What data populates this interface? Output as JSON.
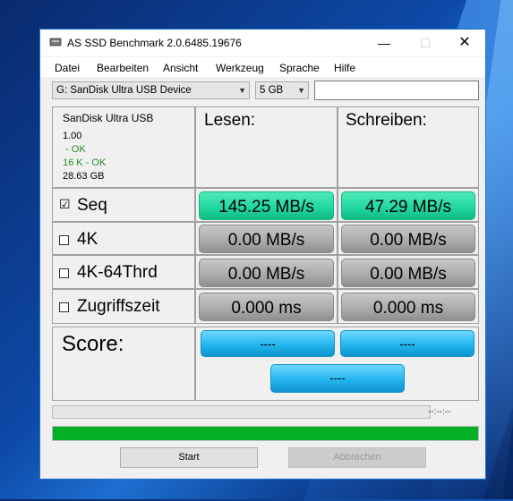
{
  "window": {
    "title": "AS SSD Benchmark 2.0.6485.19676"
  },
  "titlebar": {
    "min_glyph": "—",
    "max_glyph": "☐",
    "close_glyph": "✕"
  },
  "menu": [
    "Datei",
    "Bearbeiten",
    "Ansicht",
    "Werkzeug",
    "Sprache",
    "Hilfe"
  ],
  "toolbar": {
    "drive_select": "G: SanDisk Ultra USB Device",
    "size_select": "5 GB",
    "text_value": ""
  },
  "device": {
    "name": "SanDisk Ultra USB",
    "version": "1.00",
    "driver_status": " - OK",
    "alignment_status": "16 K - OK",
    "capacity": "28.63 GB"
  },
  "columns": {
    "read": "Lesen:",
    "write": "Schreiben:"
  },
  "rows": [
    {
      "label": "Seq",
      "checked": true,
      "read": "145.25 MB/s",
      "write": "47.29 MB/s"
    },
    {
      "label": "4K",
      "checked": false,
      "read": "0.00 MB/s",
      "write": "0.00 MB/s"
    },
    {
      "label": "4K-64Thrd",
      "checked": false,
      "read": "0.00 MB/s",
      "write": "0.00 MB/s"
    },
    {
      "label": "Zugriffszeit",
      "checked": false,
      "read": "0.000 ms",
      "write": "0.000 ms"
    }
  ],
  "score": {
    "label": "Score:",
    "read": "----",
    "write": "----",
    "total": "----"
  },
  "progress": {
    "elapsed": "--:--:--",
    "main_fill_fraction": 1.0
  },
  "buttons": {
    "start": "Start",
    "cancel": "Abbrechen"
  },
  "icons": {
    "checked_glyph": "☑",
    "unchecked_glyph": "☐"
  },
  "colors": {
    "result_green": "#1fd79d",
    "result_gray": "#a9a9a9",
    "score_blue": "#23b6ee",
    "progress_green": "#06b025"
  }
}
